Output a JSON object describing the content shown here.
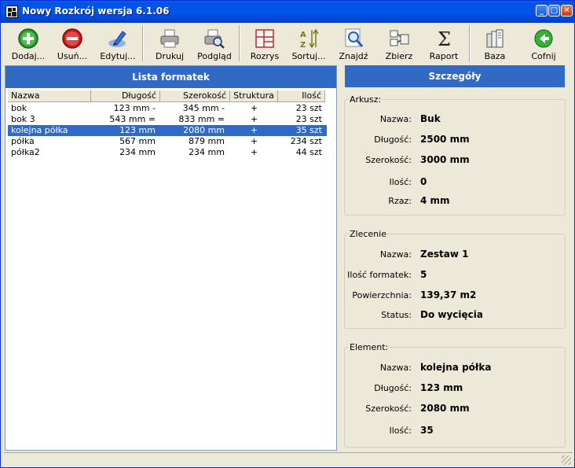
{
  "window": {
    "title": "Nowy Rozkrój wersja 6.1.06"
  },
  "toolbar": {
    "items": [
      {
        "label": "Dodaj...",
        "icon": "add-icon"
      },
      {
        "label": "Usuń...",
        "icon": "remove-icon"
      },
      {
        "label": "Edytuj...",
        "icon": "edit-icon"
      },
      {
        "label": "Drukuj",
        "icon": "printer-icon"
      },
      {
        "label": "Podgląd",
        "icon": "print-preview-icon"
      },
      {
        "label": "Rozrys",
        "icon": "cutting-layout-icon"
      },
      {
        "label": "Sortuj...",
        "icon": "sort-az-icon"
      },
      {
        "label": "Znajdź",
        "icon": "find-icon"
      },
      {
        "label": "Zbierz",
        "icon": "collect-icon"
      },
      {
        "label": "Raport",
        "icon": "sigma-icon"
      },
      {
        "label": "Baza",
        "icon": "database-icon"
      },
      {
        "label": "Cofnij",
        "icon": "back-icon"
      }
    ]
  },
  "list": {
    "title": "Lista formatek",
    "columns": [
      "Nazwa",
      "Długość",
      "Szerokość",
      "Struktura",
      "Ilość"
    ],
    "rows": [
      {
        "nazwa": "bok",
        "dlugosc": "123 mm -",
        "szerokosc": "345 mm -",
        "struktura": "+",
        "ilosc": "23 szt",
        "selected": false
      },
      {
        "nazwa": "bok 3",
        "dlugosc": "543 mm =",
        "szerokosc": "833 mm =",
        "struktura": "+",
        "ilosc": "23 szt",
        "selected": false
      },
      {
        "nazwa": "kolejna półka",
        "dlugosc": "123 mm",
        "szerokosc": "2080 mm",
        "struktura": "+",
        "ilosc": "35 szt",
        "selected": true
      },
      {
        "nazwa": "półka",
        "dlugosc": "567 mm",
        "szerokosc": "879 mm",
        "struktura": "+",
        "ilosc": "234 szt",
        "selected": false
      },
      {
        "nazwa": "półka2",
        "dlugosc": "234 mm",
        "szerokosc": "234 mm",
        "struktura": "+",
        "ilosc": "44 szt",
        "selected": false
      }
    ]
  },
  "details": {
    "title": "Szczegóły",
    "arkusz": {
      "title": "Arkusz:",
      "fields": [
        {
          "label": "Nazwa:",
          "value": "Buk"
        },
        {
          "label": "Długość:",
          "value": "2500 mm"
        },
        {
          "label": "Szerokość:",
          "value": "3000 mm"
        },
        {
          "label": "Ilość:",
          "value": "0"
        },
        {
          "label": "Rzaz:",
          "value": "4 mm"
        }
      ]
    },
    "zlecenie": {
      "title": "Zlecenie",
      "fields": [
        {
          "label": "Nazwa:",
          "value": "Zestaw 1"
        },
        {
          "label": "Ilość formatek:",
          "value": "5"
        },
        {
          "label": "Powierzchnia:",
          "value": "139,37 m2"
        },
        {
          "label": "Status:",
          "value": "Do wycięcia"
        }
      ]
    },
    "element": {
      "title": "Element:",
      "fields": [
        {
          "label": "Nazwa:",
          "value": "kolejna półka"
        },
        {
          "label": "Długość:",
          "value": "123 mm"
        },
        {
          "label": "Szerokość:",
          "value": "2080 mm"
        },
        {
          "label": "Ilość:",
          "value": "35"
        }
      ]
    }
  },
  "colors": {
    "header_blue": "#316ac5",
    "face": "#ece9d8"
  }
}
